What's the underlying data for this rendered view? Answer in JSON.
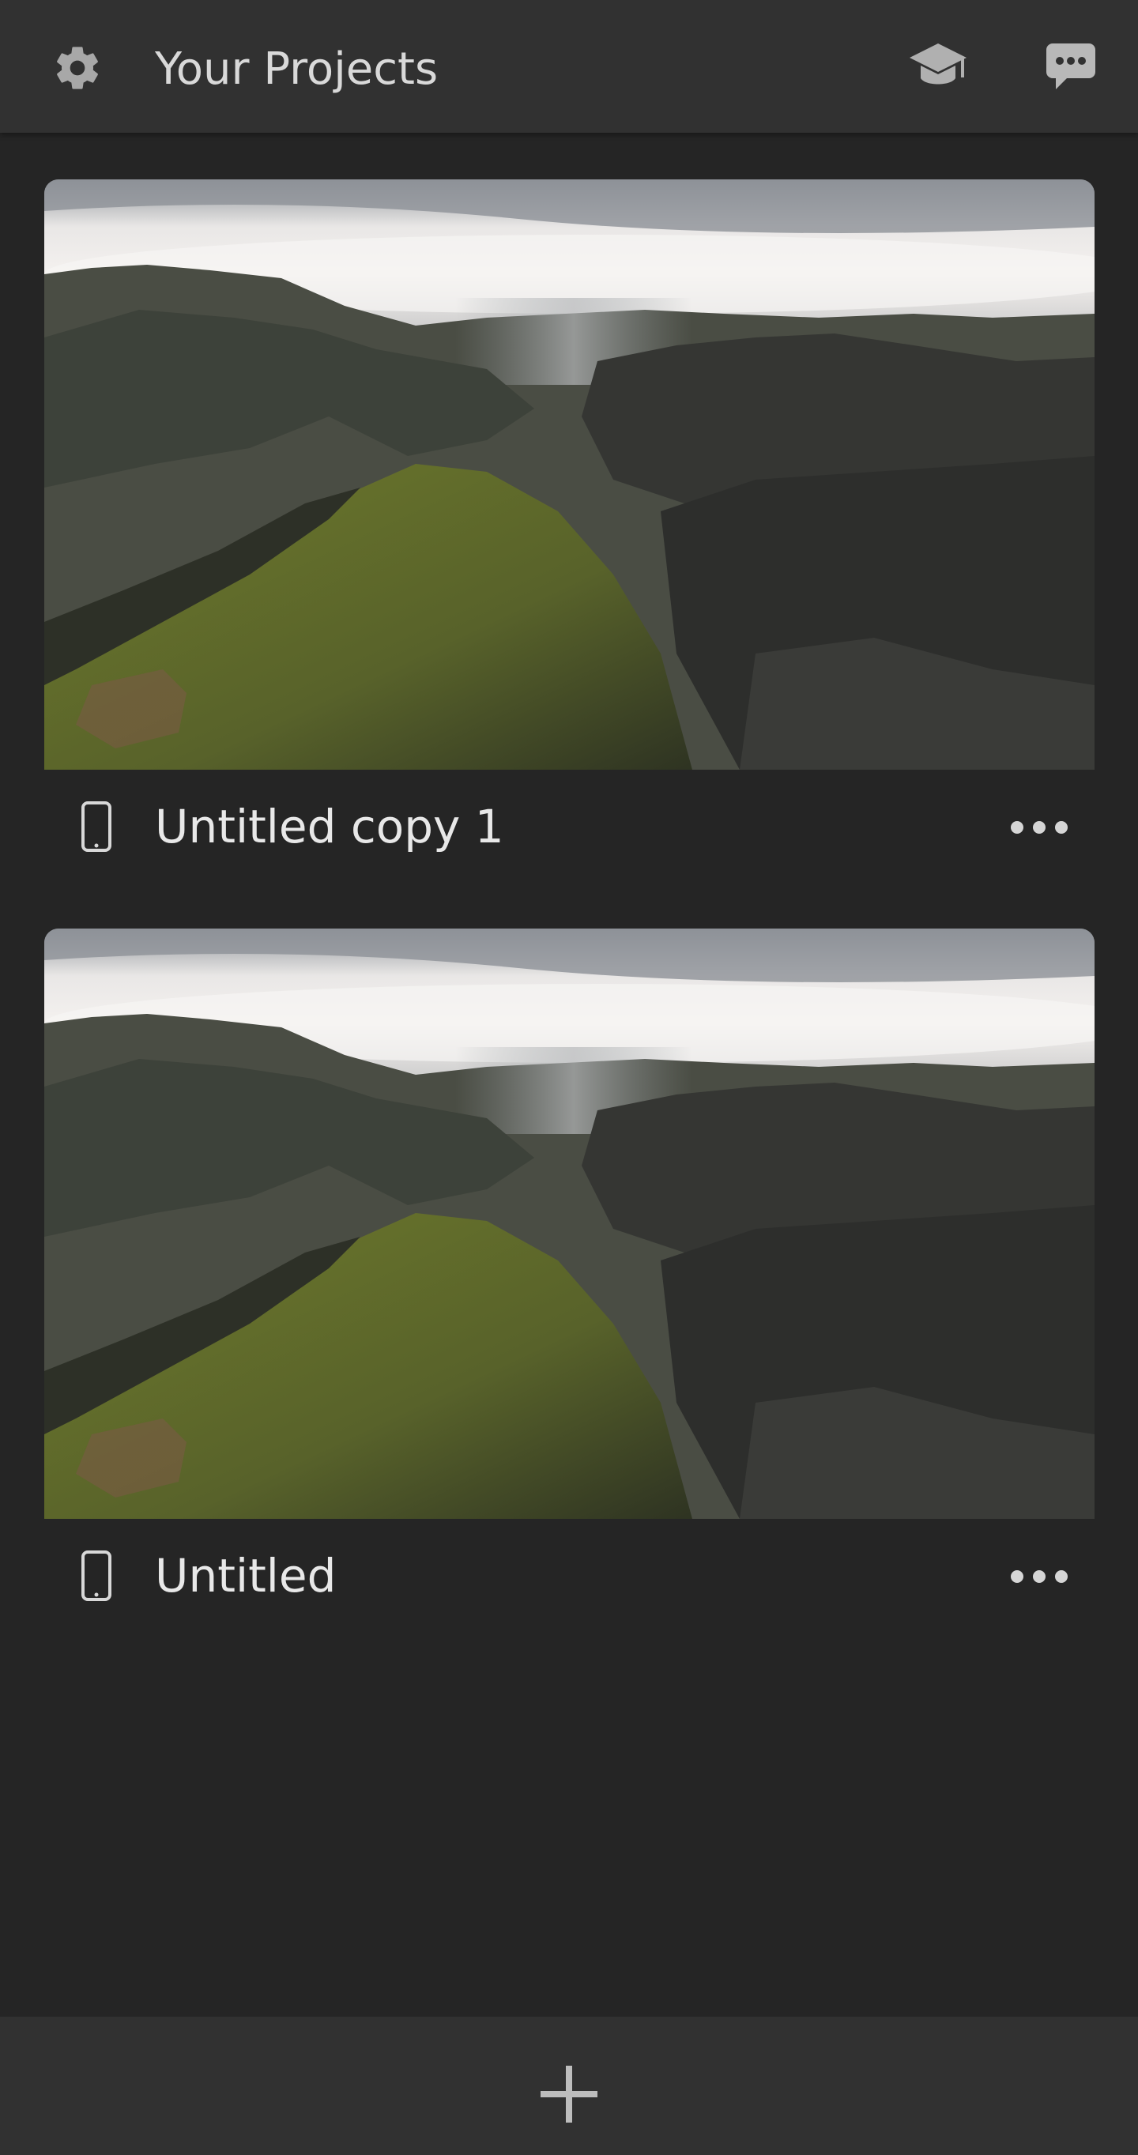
{
  "header": {
    "title": "Your Projects",
    "settings_icon": "gear-icon",
    "learn_icon": "graduation-cap-icon",
    "feedback_icon": "chat-bubble-icon"
  },
  "projects": [
    {
      "name": "Untitled copy 1",
      "device_icon": "phone-icon",
      "menu_icon": "more-horizontal-icon"
    },
    {
      "name": "Untitled",
      "device_icon": "phone-icon",
      "menu_icon": "more-horizontal-icon"
    }
  ],
  "footer": {
    "add_icon": "plus-icon"
  },
  "colors": {
    "background": "#252525",
    "bar": "#313131",
    "text": "#e8e8e8",
    "icon": "#bdbdbd"
  }
}
